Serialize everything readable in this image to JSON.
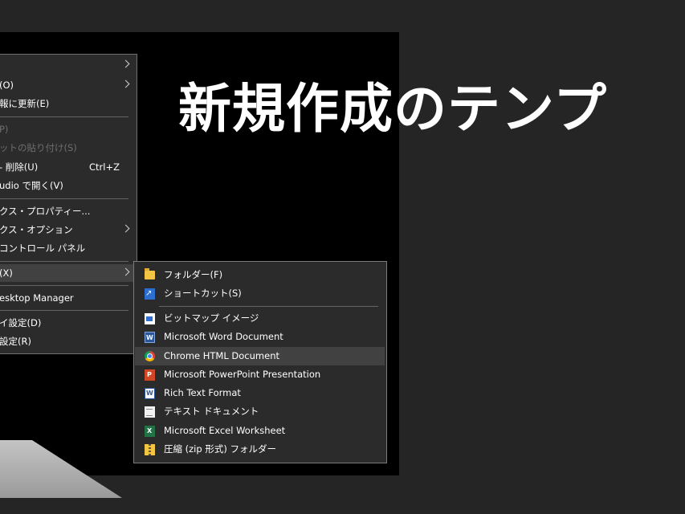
{
  "headline": "新規作成のテンプ",
  "context_menu": {
    "items": [
      {
        "label": "",
        "shortcut": "",
        "submenu": true,
        "disabled": false
      },
      {
        "label": "(O)",
        "shortcut": "",
        "submenu": true,
        "disabled": false
      },
      {
        "label": "報に更新(E)",
        "shortcut": "",
        "submenu": false,
        "disabled": false
      },
      {
        "label": "P)",
        "shortcut": "",
        "submenu": false,
        "disabled": true
      },
      {
        "label": "ットの貼り付け(S)",
        "shortcut": "",
        "submenu": false,
        "disabled": true
      },
      {
        "label": "- 削除(U)",
        "shortcut": "Ctrl+Z",
        "submenu": false,
        "disabled": false
      },
      {
        "label": "udio で開く(V)",
        "shortcut": "",
        "submenu": false,
        "disabled": false
      },
      {
        "label": "クス・プロパティー...",
        "shortcut": "",
        "submenu": false,
        "disabled": false
      },
      {
        "label": "クス・オプション",
        "shortcut": "",
        "submenu": true,
        "disabled": false
      },
      {
        "label": "コントロール パネル",
        "shortcut": "",
        "submenu": false,
        "disabled": false
      },
      {
        "label": "(X)",
        "shortcut": "",
        "submenu": true,
        "disabled": false
      },
      {
        "label": "esktop Manager",
        "shortcut": "",
        "submenu": false,
        "disabled": false
      },
      {
        "label": "イ設定(D)",
        "shortcut": "",
        "submenu": false,
        "disabled": false
      },
      {
        "label": "設定(R)",
        "shortcut": "",
        "submenu": false,
        "disabled": false
      }
    ]
  },
  "new_submenu": {
    "items": [
      {
        "label": "フォルダー(F)",
        "icon": "folder-icon"
      },
      {
        "label": "ショートカット(S)",
        "icon": "shortcut-icon"
      },
      {
        "label": "ビットマップ イメージ",
        "icon": "bitmap-icon"
      },
      {
        "label": "Microsoft Word Document",
        "icon": "word-document-icon"
      },
      {
        "label": "Chrome HTML Document",
        "icon": "chrome-icon"
      },
      {
        "label": "Microsoft PowerPoint Presentation",
        "icon": "powerpoint-icon"
      },
      {
        "label": "Rich Text Format",
        "icon": "rich-text-icon"
      },
      {
        "label": "テキスト ドキュメント",
        "icon": "text-document-icon"
      },
      {
        "label": "Microsoft Excel Worksheet",
        "icon": "excel-icon"
      },
      {
        "label": "圧縮 (zip 形式) フォルダー",
        "icon": "zip-folder-icon"
      }
    ]
  }
}
